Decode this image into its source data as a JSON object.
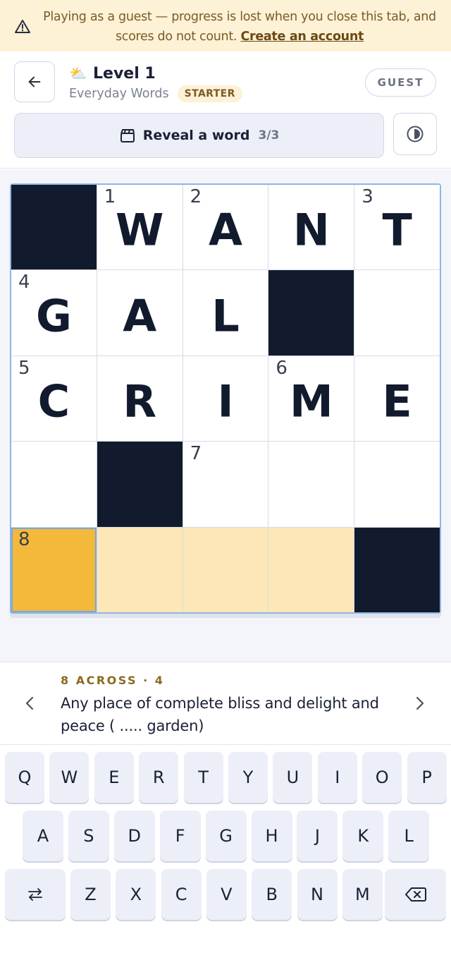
{
  "banner": {
    "text": "Playing as a guest — progress is lost when you close this tab, and scores do not count.",
    "link": "Create an account"
  },
  "header": {
    "level_title": "Level 1",
    "category": "Everyday Words",
    "badge": "STARTER",
    "guest_label": "GUEST",
    "reveal_label": "Reveal a word",
    "reveal_count": "3/3"
  },
  "grid": {
    "cells": [
      {
        "block": true
      },
      {
        "num": "1",
        "letter": "W"
      },
      {
        "num": "2",
        "letter": "A"
      },
      {
        "letter": "N"
      },
      {
        "num": "3",
        "letter": "T"
      },
      {
        "num": "4",
        "letter": "G"
      },
      {
        "letter": "A"
      },
      {
        "letter": "L"
      },
      {
        "block": true
      },
      {},
      {
        "num": "5",
        "letter": "C"
      },
      {
        "letter": "R"
      },
      {
        "letter": "I"
      },
      {
        "num": "6",
        "letter": "M"
      },
      {
        "letter": "E"
      },
      {},
      {
        "block": true
      },
      {
        "num": "7"
      },
      {},
      {},
      {
        "num": "8",
        "state": "active"
      },
      {
        "state": "word"
      },
      {
        "state": "word"
      },
      {
        "state": "word"
      },
      {
        "block": true
      }
    ]
  },
  "clue": {
    "ref": "8 ACROSS · 4",
    "text": "Any place of complete bliss and delight and peace ( ..... garden)"
  },
  "keyboard": {
    "row1": [
      "Q",
      "W",
      "E",
      "R",
      "T",
      "Y",
      "U",
      "I",
      "O",
      "P"
    ],
    "row2": [
      "A",
      "S",
      "D",
      "F",
      "G",
      "H",
      "J",
      "K",
      "L"
    ],
    "row3": [
      "Z",
      "X",
      "C",
      "V",
      "B",
      "N",
      "M"
    ]
  },
  "colors": {
    "accent_active": "#f4b83a",
    "word_highlight": "#fde7b8",
    "block": "#121a2e",
    "banner_bg": "#fdf1d6"
  }
}
